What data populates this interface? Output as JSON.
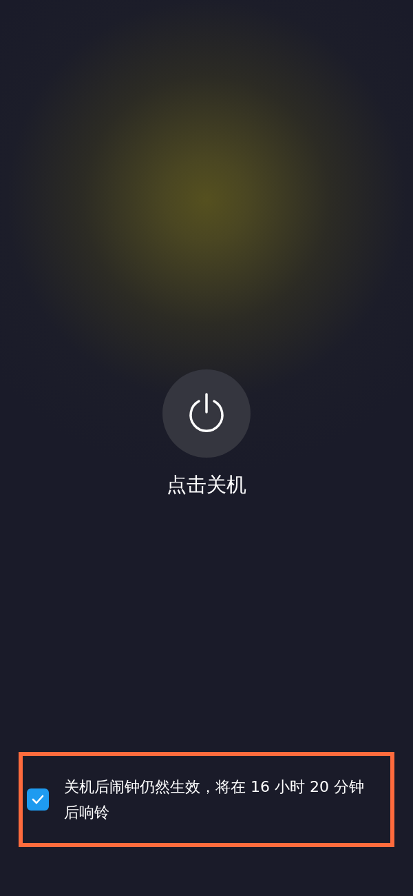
{
  "power_button": {
    "label": "点击关机"
  },
  "alarm_option": {
    "checked": true,
    "text": "关机后闹钟仍然生效，将在 16 小时 20 分钟后响铃"
  }
}
